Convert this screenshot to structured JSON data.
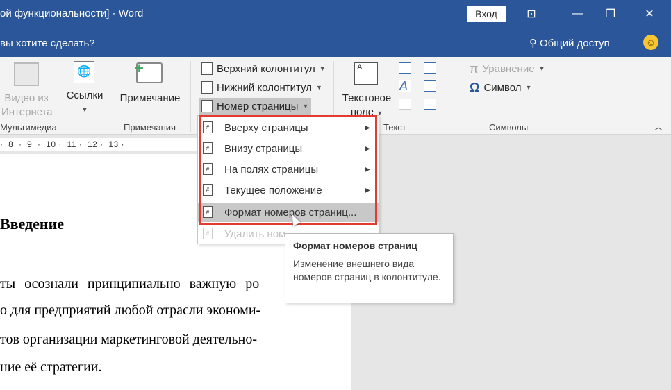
{
  "titlebar": {
    "title": "ой функциональности]  -  Word",
    "login_label": "Вход"
  },
  "tellbar": {
    "tell_me": "вы хотите сделать?",
    "share_label": "Общий доступ"
  },
  "ribbon": {
    "media": {
      "video_line1": "Видео из",
      "video_line2": "Интернета",
      "group_label": "Мультимедиа"
    },
    "links": {
      "label": "Ссылки"
    },
    "comments": {
      "button_label": "Примечание",
      "group_label": "Примечания"
    },
    "header_footer": {
      "header_label": "Верхний колонтитул",
      "footer_label": "Нижний колонтитул",
      "page_number_label": "Номер страницы"
    },
    "text": {
      "textbox_line1": "Текстовое",
      "textbox_line2": "поле",
      "group_label": "Текст"
    },
    "symbols": {
      "equation_label": "Уравнение",
      "symbol_label": "Символ",
      "group_label": "Символы"
    }
  },
  "ruler": {
    "numbers": "·  8  ·  9  ·  10 ·  11 ·  12 ·  13 ·"
  },
  "document": {
    "heading": "Введение",
    "line1": "ты осознали принципиально важную ро",
    "line2": "о для предприятий любой отрасли экономи-",
    "line3": "тов организации маркетинговой деятельно-",
    "line4": "ние её стратегии."
  },
  "page_number_menu": {
    "items": [
      {
        "label": "Вверху страницы"
      },
      {
        "label": "Внизу страницы"
      },
      {
        "label": "На полях страницы"
      },
      {
        "label": "Текущее положение"
      },
      {
        "label": "Формат номеров страниц..."
      },
      {
        "label": "Удалить ном"
      }
    ]
  },
  "tooltip": {
    "title": "Формат номеров страниц",
    "description": "Изменение внешнего вида номеров страниц в колонтитуле."
  },
  "colors": {
    "titlebar_bg": "#2b579a",
    "highlight": "#e53b2e"
  }
}
